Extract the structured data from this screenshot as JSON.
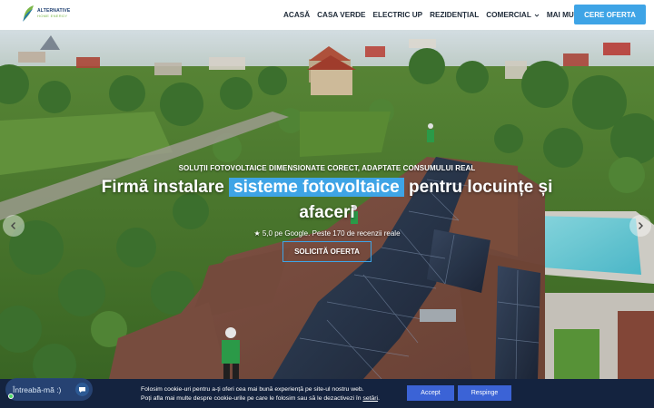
{
  "brand": {
    "line1": "ALTERNATIVE",
    "line2": "HOME ENERGY",
    "accent_color": "#3ea4e6",
    "logo_icon": "leaf-energy-logo-icon"
  },
  "nav": {
    "items": [
      {
        "label": "ACASĂ",
        "dropdown": false
      },
      {
        "label": "CASA VERDE",
        "dropdown": false
      },
      {
        "label": "ELECTRIC UP",
        "dropdown": false
      },
      {
        "label": "REZIDENȚIAL",
        "dropdown": false
      },
      {
        "label": "COMERCIAL",
        "dropdown": true
      },
      {
        "label": "MAI MULTE",
        "dropdown": true
      }
    ],
    "cta_label": "CERE OFERTA"
  },
  "hero": {
    "eyebrow": "SOLUȚII FOTOVOLTAICE DIMENSIONATE CORECT, ADAPTATE CONSUMULUI REAL",
    "headline_pre": "Firmă instalare ",
    "headline_highlight": "sisteme fotovoltaice",
    "headline_post": " pentru locuințe și afaceri",
    "rating": "★ 5,0 pe Google. Peste 170 de recenzii reale",
    "button_label": "SOLICITĂ OFERTA",
    "prev_icon": "chevron-left-icon",
    "next_icon": "chevron-right-icon"
  },
  "chat": {
    "placeholder": "Întreabă-mă :)",
    "icon": "chat-bubble-icon",
    "status_color": "#4cd964"
  },
  "cookie": {
    "line1": "Folosim cookie-uri pentru a-ți oferi cea mai bună experiență pe site-ul nostru web.",
    "line2_pre": "Poți afla mai multe despre cookie-urile pe care le folosim sau să le dezactivezi în ",
    "line2_link": "setări",
    "line2_post": ".",
    "accept_label": "Accept",
    "reject_label": "Respinge",
    "bar_color": "#14233f",
    "button_color": "#3b63d6"
  }
}
